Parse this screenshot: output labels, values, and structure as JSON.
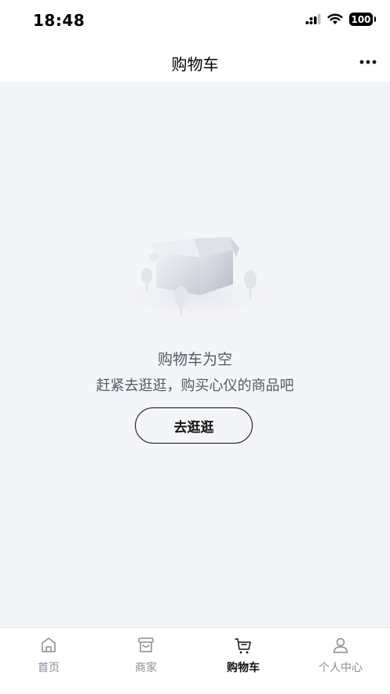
{
  "status_bar": {
    "time": "18:48",
    "battery": "100"
  },
  "nav": {
    "title": "购物车",
    "more_icon": "more-dots-icon"
  },
  "empty_state": {
    "illustration": "empty-box-icon",
    "title": "购物车为空",
    "subtitle": "赶紧去逛逛，购买心仪的商品吧",
    "button_label": "去逛逛"
  },
  "tabs": [
    {
      "label": "首页",
      "icon": "home-icon",
      "active": false
    },
    {
      "label": "商家",
      "icon": "store-icon",
      "active": false
    },
    {
      "label": "购物车",
      "icon": "cart-icon",
      "active": true
    },
    {
      "label": "个人中心",
      "icon": "person-icon",
      "active": false
    }
  ],
  "colors": {
    "page_background": "#f4f5f9",
    "text_primary": "#111111",
    "text_secondary": "#555a62",
    "tab_inactive": "#888c94"
  }
}
